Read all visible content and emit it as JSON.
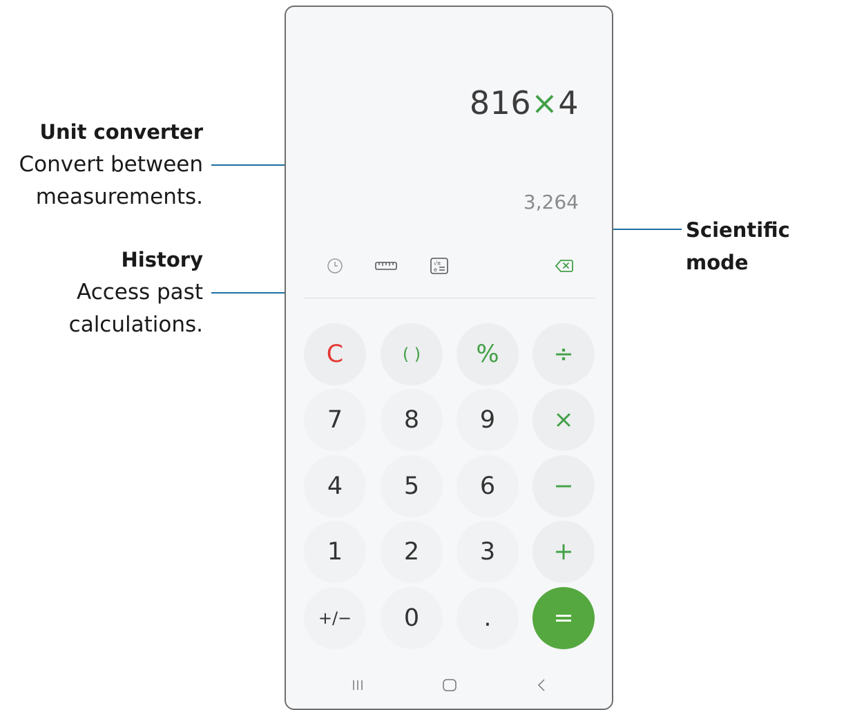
{
  "callouts": {
    "unit_converter": {
      "title": "Unit converter",
      "line1": "Convert between",
      "line2": "measurements."
    },
    "history": {
      "title": "History",
      "line1": "Access past",
      "line2": "calculations."
    },
    "scientific": {
      "title": "Scientific mode"
    }
  },
  "display": {
    "expression_left": "816",
    "expression_op": "×",
    "expression_right": "4",
    "result": "3,264"
  },
  "toolbar": {
    "icons": [
      "history-icon",
      "ruler-icon",
      "scientific-icon",
      "backspace-icon"
    ]
  },
  "keypad": {
    "row1": [
      "C",
      "( )",
      "%",
      "÷"
    ],
    "row2": [
      "7",
      "8",
      "9",
      "×"
    ],
    "row3": [
      "4",
      "5",
      "6",
      "−"
    ],
    "row4": [
      "1",
      "2",
      "3",
      "+"
    ],
    "row5": [
      "+/−",
      "0",
      ".",
      "="
    ]
  },
  "navbar": {
    "icons": [
      "recents-icon",
      "home-icon",
      "back-icon"
    ]
  },
  "colors": {
    "accent": "#43a047",
    "clear": "#e53935",
    "equals_bg": "#55a83f",
    "callout_line": "#1b6fa3"
  }
}
